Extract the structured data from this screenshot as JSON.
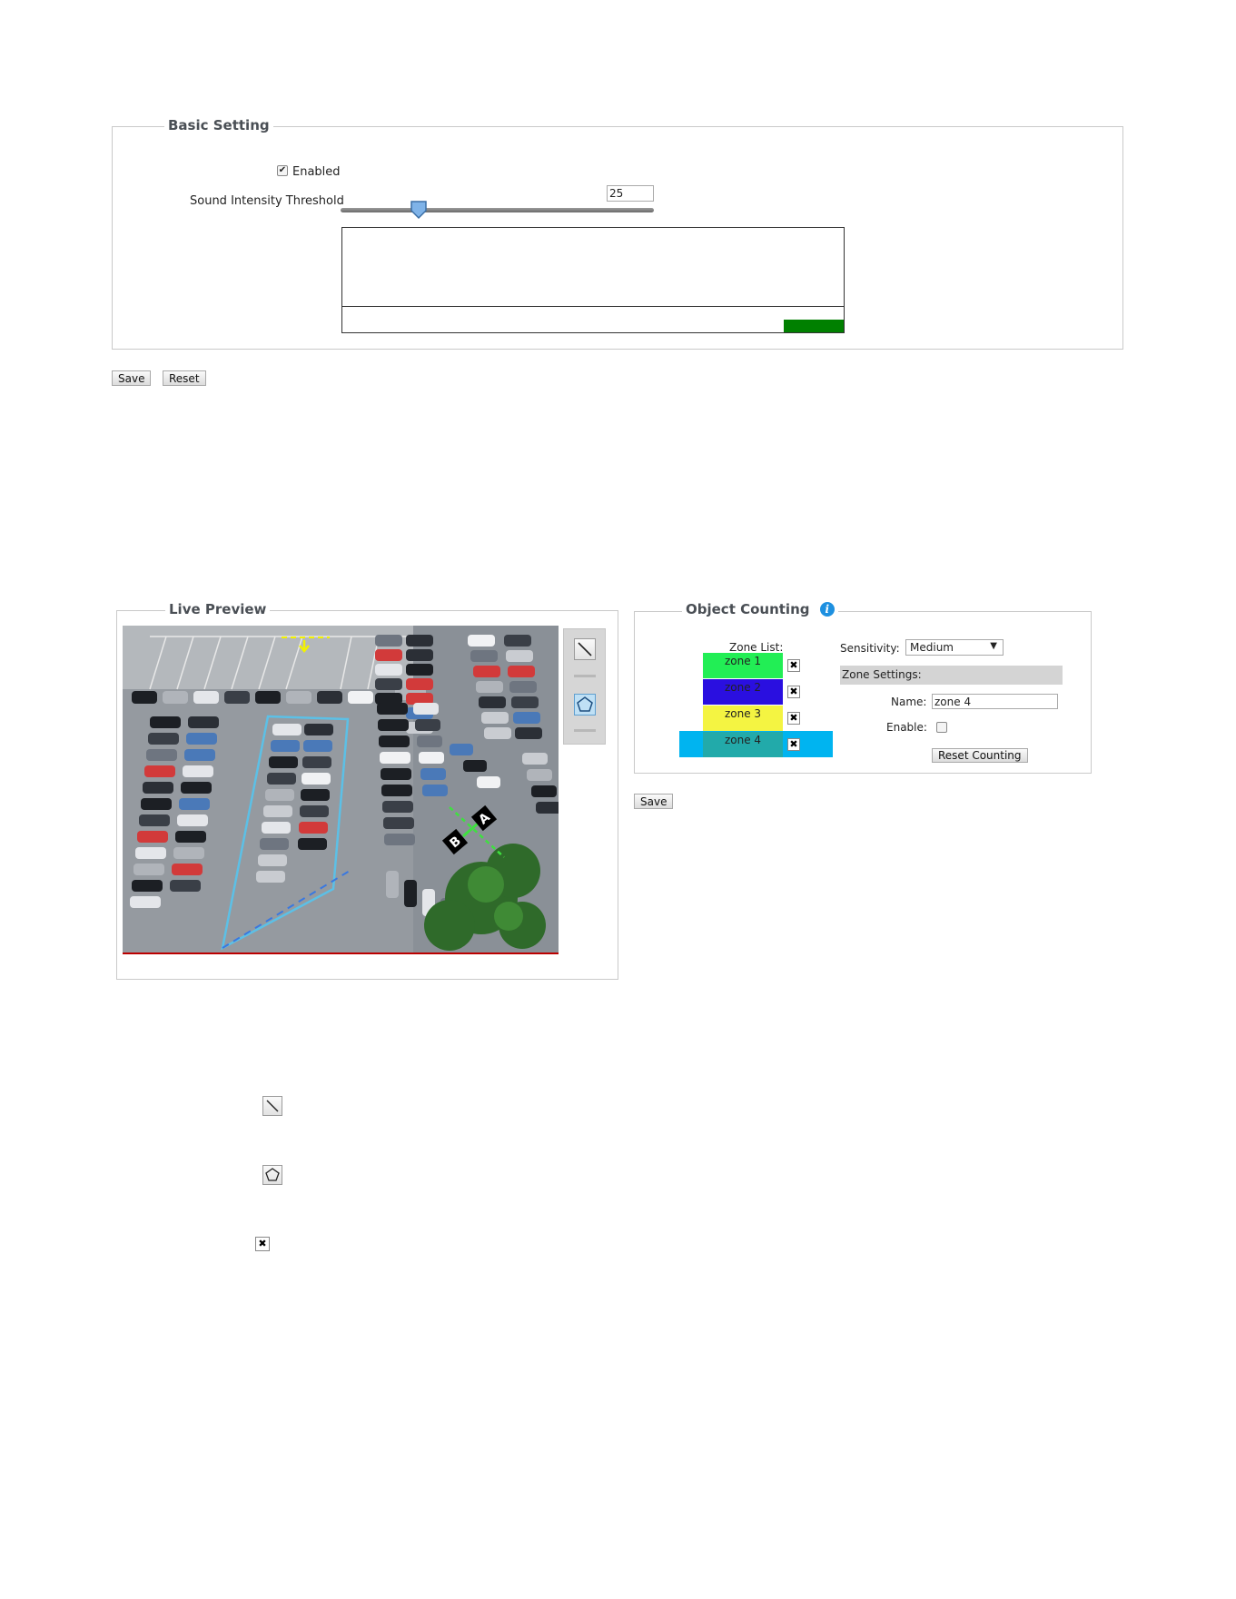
{
  "basic_setting": {
    "legend": "Basic Setting",
    "enabled_label": "Enabled",
    "enabled_checked": true,
    "threshold_label": "Sound Intensity Threshold",
    "threshold_value": "25",
    "slider_level_fraction": 0.25,
    "meter_fill_color": "#008000",
    "save_label": "Save",
    "reset_label": "Reset"
  },
  "live_preview": {
    "legend": "Live Preview",
    "tools": [
      {
        "icon": "line-tool-icon"
      },
      {
        "icon": "polygon-tool-icon"
      }
    ],
    "line_markers": [
      "A",
      "B"
    ]
  },
  "object_counting": {
    "legend": "Object Counting",
    "info_icon": "info-icon",
    "zone_list_label": "Zone List:",
    "zones": [
      {
        "name": "zone 1",
        "color": "#22ee55"
      },
      {
        "name": "zone 2",
        "color": "#2a0fe0"
      },
      {
        "name": "zone 3",
        "color": "#f4f442"
      },
      {
        "name": "zone 4",
        "color": "#22aaaa"
      }
    ],
    "selected_zone_highlight": "#00b4f0",
    "sensitivity_label": "Sensitivity:",
    "sensitivity_value": "Medium",
    "zone_settings_header": "Zone Settings:",
    "name_label": "Name:",
    "name_value": "zone 4",
    "enable_label": "Enable:",
    "enable_checked": false,
    "reset_counting_label": "Reset Counting",
    "save_label": "Save"
  },
  "legend_icons": [
    {
      "icon": "line-tool-icon"
    },
    {
      "icon": "polygon-tool-icon"
    },
    {
      "icon": "delete-icon",
      "glyph": "✖"
    }
  ]
}
